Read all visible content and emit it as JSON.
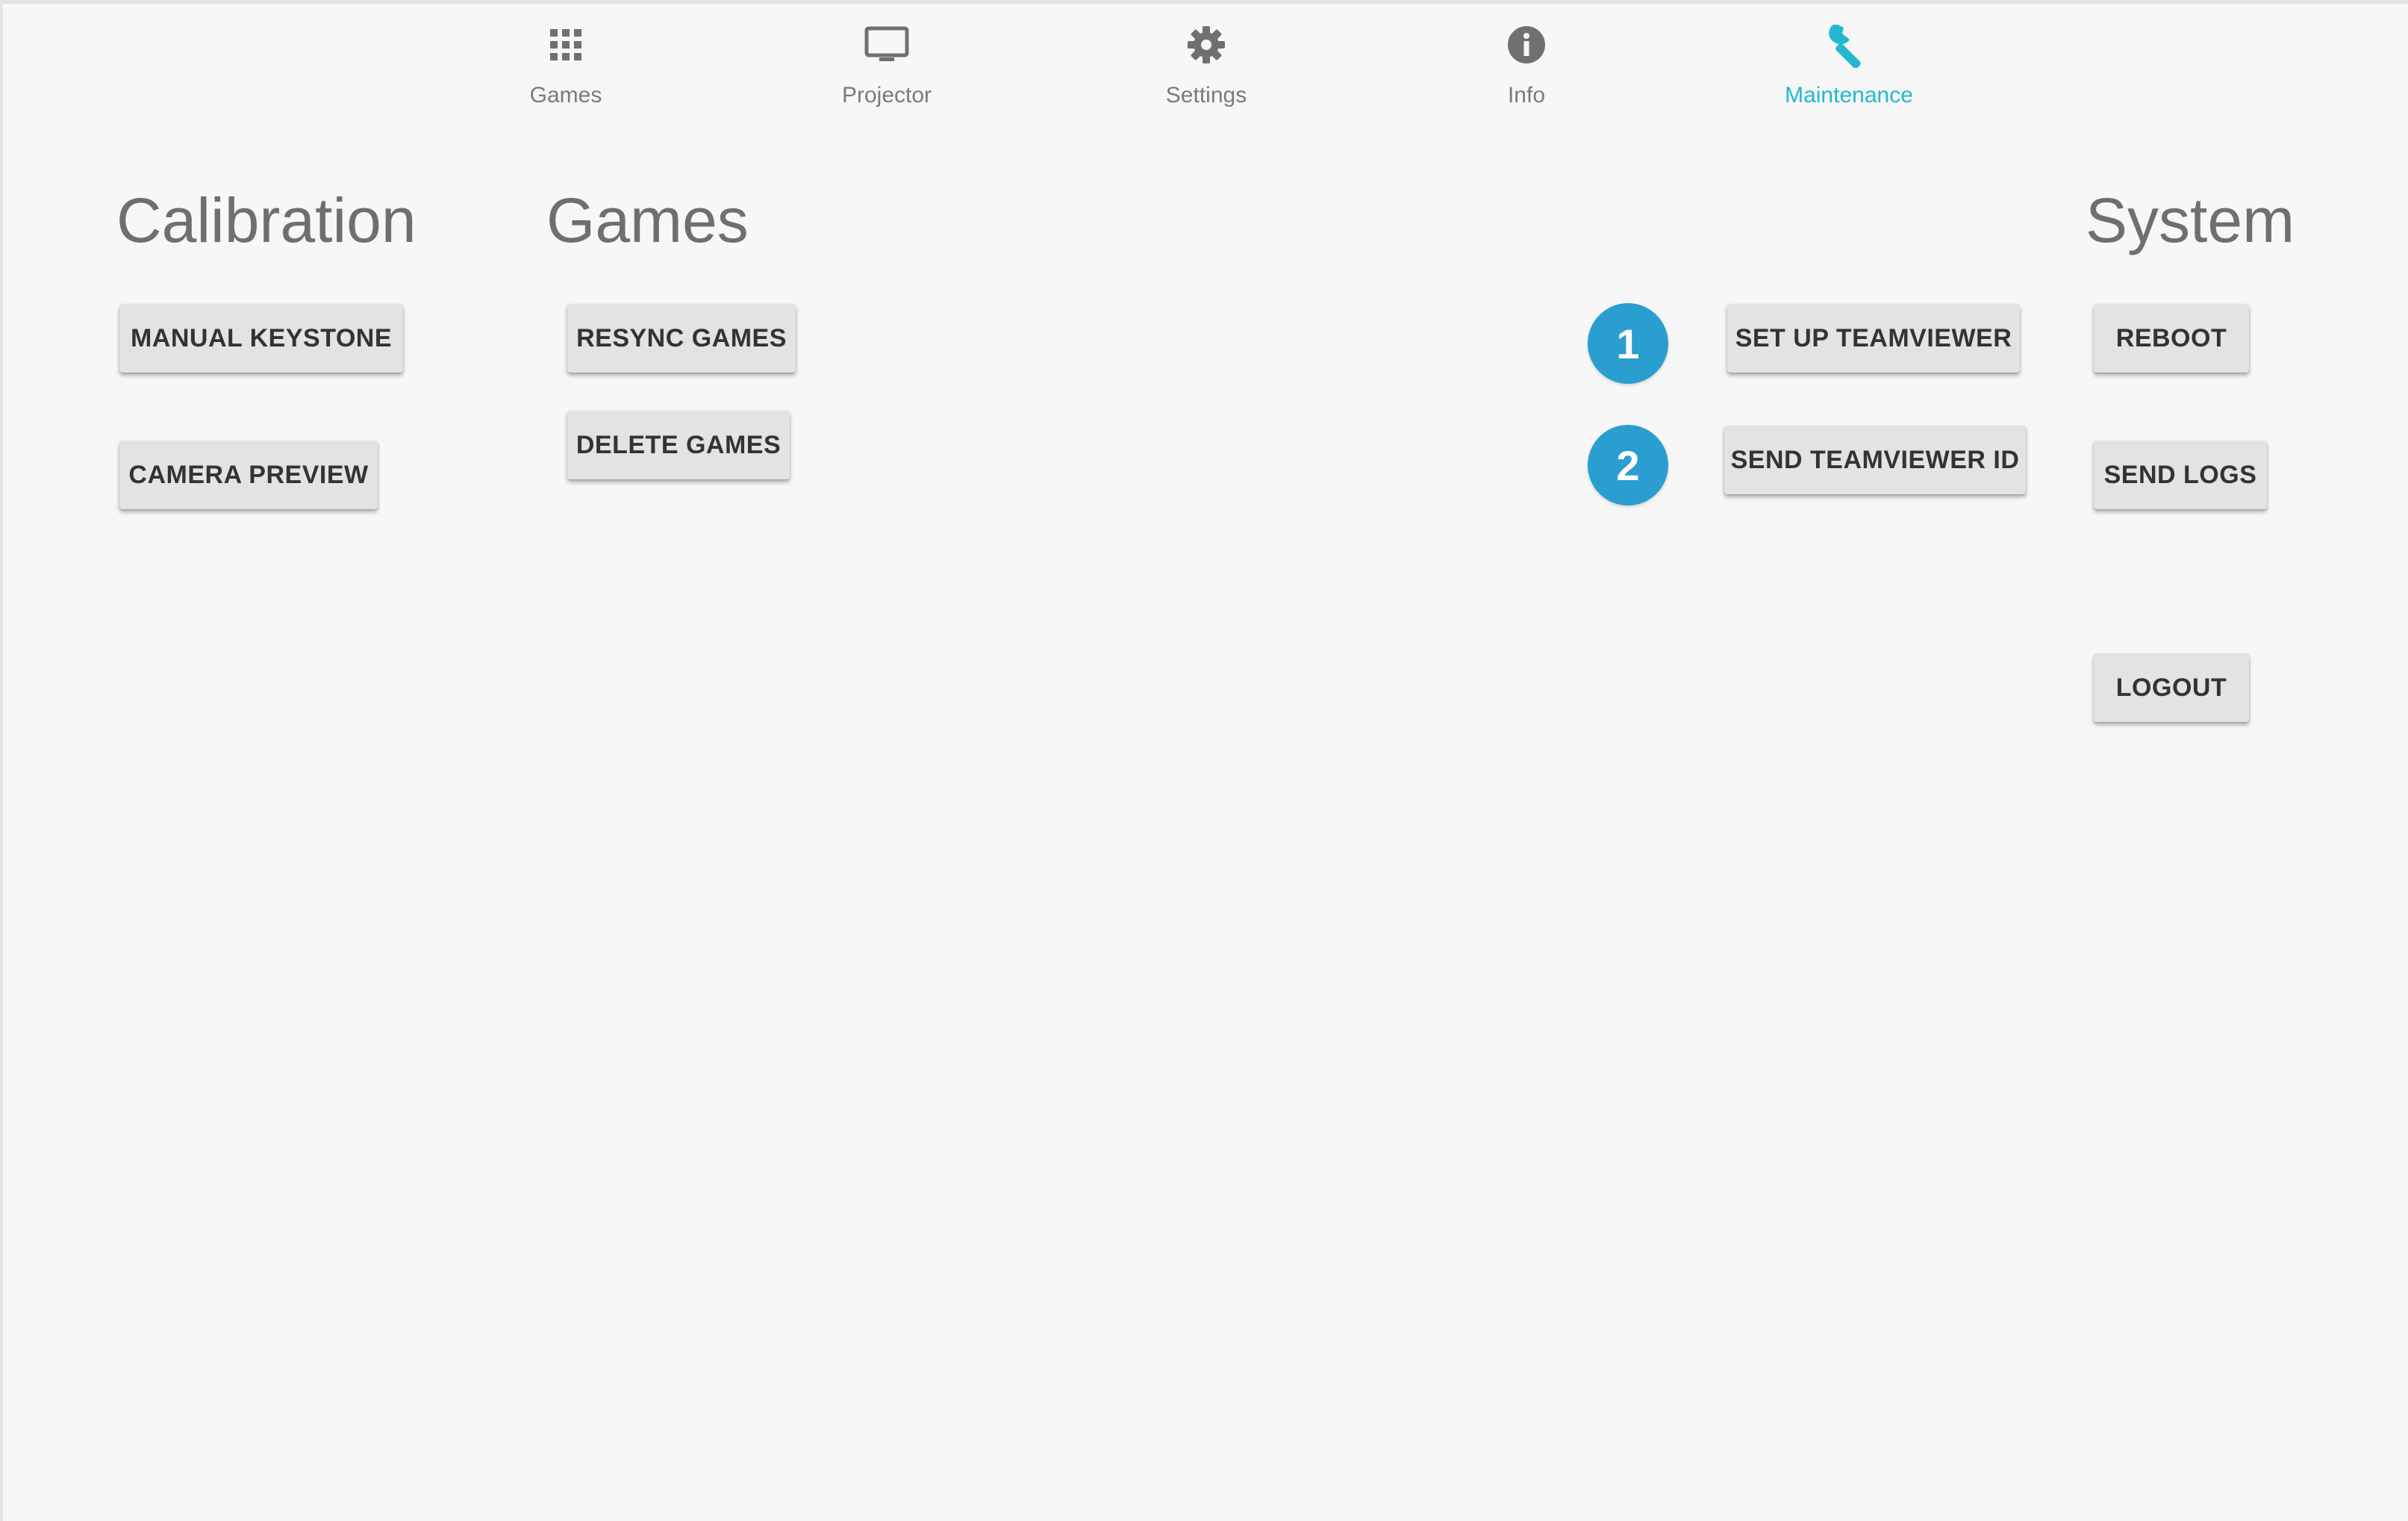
{
  "nav": {
    "tabs": [
      {
        "label": "Games",
        "icon": "grid-icon",
        "active": false
      },
      {
        "label": "Projector",
        "icon": "monitor-icon",
        "active": false
      },
      {
        "label": "Settings",
        "icon": "gear-icon",
        "active": false
      },
      {
        "label": "Info",
        "icon": "info-icon",
        "active": false
      },
      {
        "label": "Maintenance",
        "icon": "wrench-icon",
        "active": true
      }
    ],
    "active_color": "#22b8cf",
    "inactive_color": "#7a7a7a"
  },
  "sections": {
    "calibration": {
      "title": "Calibration",
      "buttons": [
        "MANUAL KEYSTONE",
        "CAMERA PREVIEW"
      ]
    },
    "games": {
      "title": "Games",
      "buttons": [
        "RESYNC GAMES",
        "DELETE GAMES"
      ]
    },
    "teamviewer": {
      "buttons": [
        "SET UP TEAMVIEWER",
        "SEND TEAMVIEWER ID"
      ],
      "markers": [
        "1",
        "2"
      ],
      "marker_color": "#2b9ed1"
    },
    "system": {
      "title": "System",
      "buttons": [
        "REBOOT",
        "SEND LOGS",
        "LOGOUT"
      ]
    }
  }
}
